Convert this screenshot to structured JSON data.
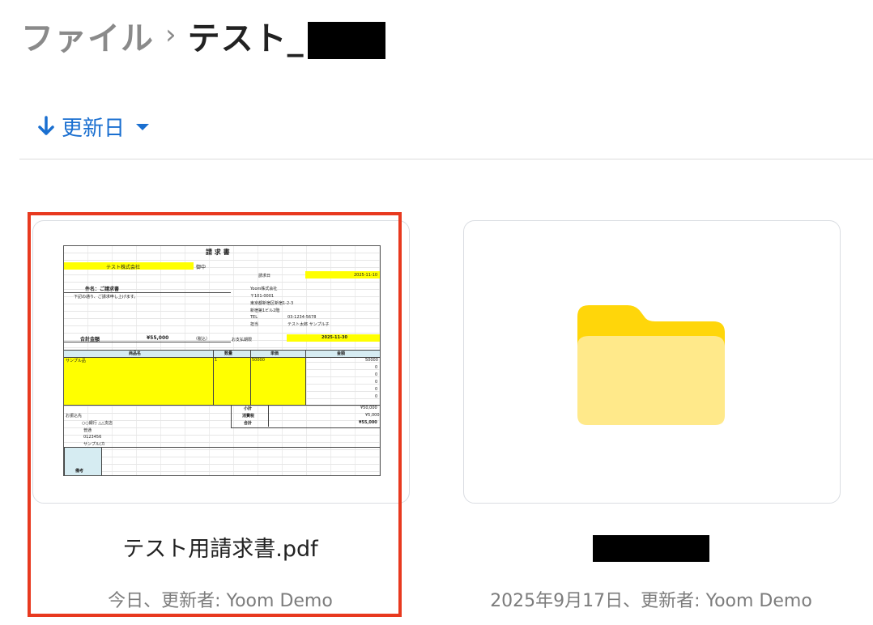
{
  "breadcrumb": {
    "parent": "ファイル",
    "separator": "›",
    "current": "テスト_"
  },
  "sort": {
    "label": "更新日"
  },
  "files": [
    {
      "name": "テスト用請求書.pdf",
      "meta": "今日、更新者: Yoom Demo",
      "type": "pdf"
    },
    {
      "name": "",
      "meta": "2025年9月17日、更新者: Yoom Demo",
      "type": "folder"
    }
  ],
  "invoice": {
    "title": "請 求 書",
    "company_to": "テスト株式会社",
    "honorific": "御中",
    "date_label": "請求日",
    "date_value": "2025-11-10",
    "subject": "件名：ご請求書",
    "note": "下記の通り、ご請求申し上げます。",
    "issuer": "Yoom株式会社",
    "zip": "〒101-0001",
    "address1": "東京都新宿区新宿1-2-3",
    "address2": "新宿第1ビル2階",
    "tel_label": "TEL",
    "tel": "03-1234-5678",
    "person_label": "担当",
    "person": "テスト太郎 サンプル子",
    "total_label": "合計金額",
    "total": "¥55,000",
    "tax_incl": "（税込）",
    "due_label": "お支払期限",
    "due_value": "2025-11-30",
    "col_item": "商品名",
    "col_qty": "数量",
    "col_unit": "単価",
    "col_amount": "金額",
    "row1_item": "サンプル品",
    "row1_qty": "1",
    "row1_unit": "50000",
    "row1_amount": "50000",
    "zero": "0",
    "subtotal_label": "小計",
    "subtotal": "¥50,000",
    "tax_label": "消費税",
    "tax": "¥5,000",
    "sum_label": "合計",
    "sum": "¥55,000",
    "bank_label": "お振込先",
    "bank1": "○○銀行 △△支店",
    "bank2": "普通",
    "bank3": "0123456",
    "bank4": "サンプル(カ",
    "remarks_label": "備考"
  },
  "colors": {
    "accent": "#1a6fd0",
    "selection": "#e8391f",
    "folder_back": "#ffd60a",
    "folder_front": "#ffe98a",
    "highlight": "#ffff00"
  }
}
